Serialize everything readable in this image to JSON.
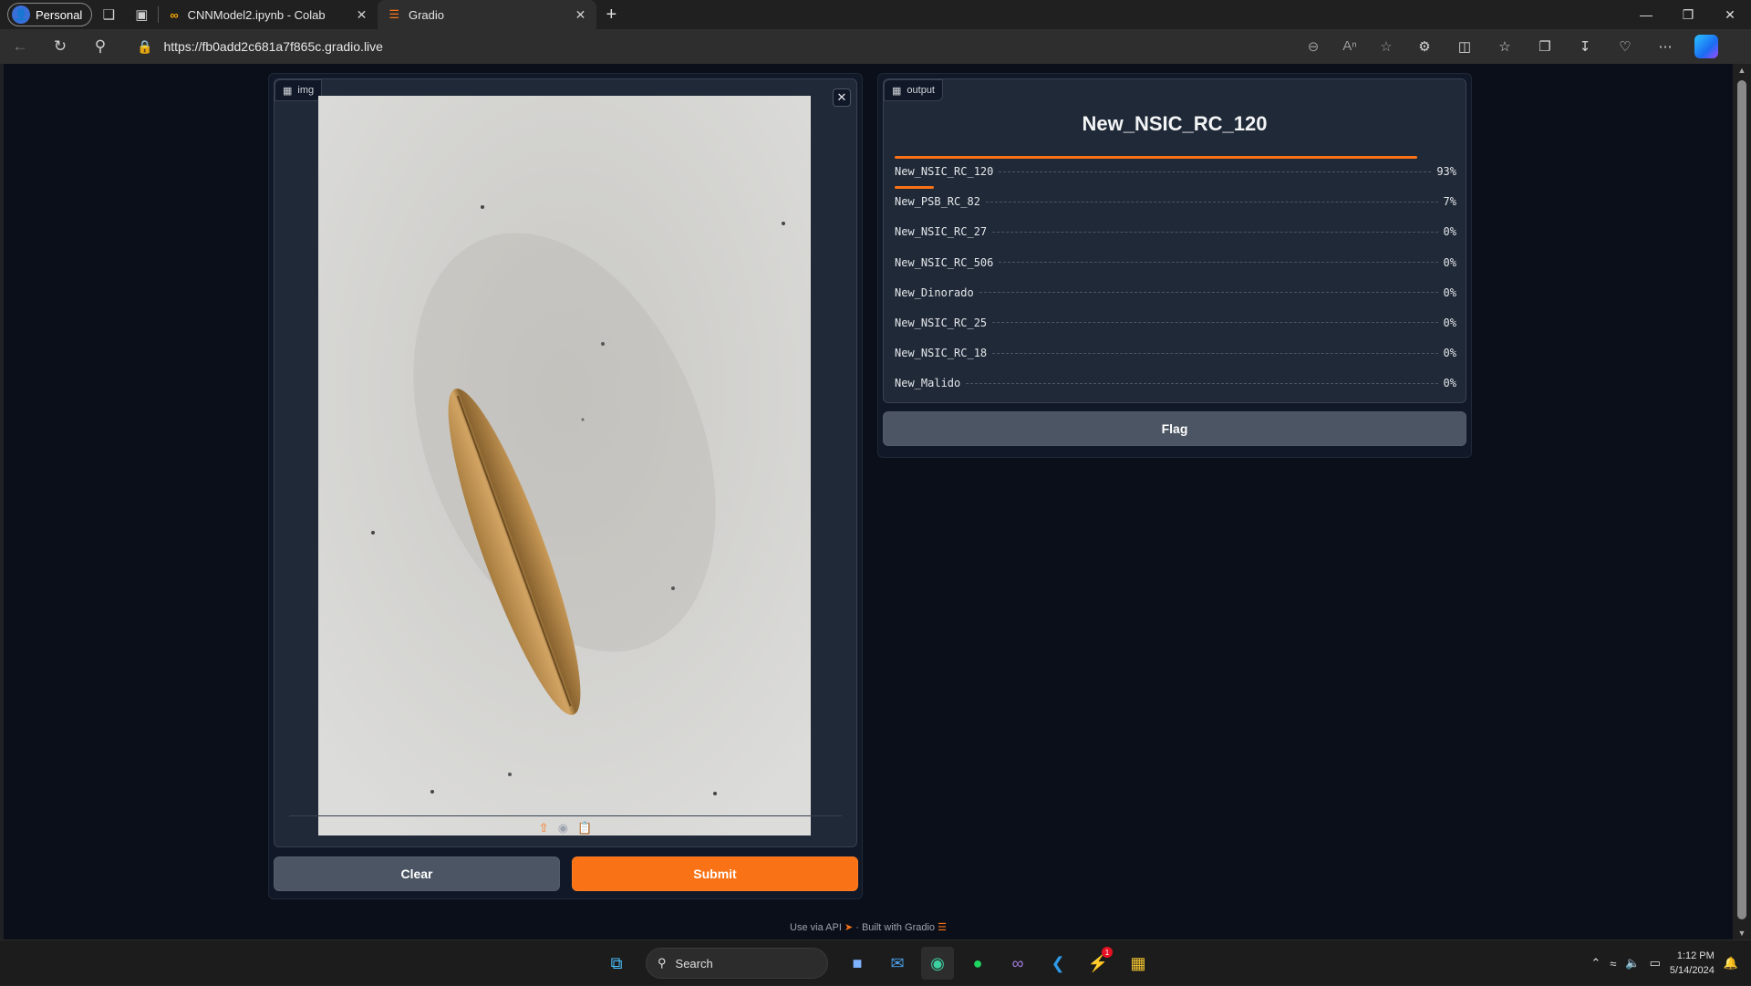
{
  "browser": {
    "profile_label": "Personal",
    "tabs": [
      {
        "label": "CNNModel2.ipynb - Colab",
        "icon": "colab-icon"
      },
      {
        "label": "Gradio",
        "icon": "gradio-icon"
      }
    ],
    "url": "https://fb0add2c681a7f865c.gradio.live"
  },
  "input_panel": {
    "block_label": "img",
    "clear_label": "Clear",
    "submit_label": "Submit"
  },
  "output_panel": {
    "block_label": "output",
    "top_label": "New_NSIC_RC_120",
    "confidences": [
      {
        "label": "New_NSIC_RC_120",
        "pct_text": "93%",
        "value": 0.93
      },
      {
        "label": "New_PSB_RC_82",
        "pct_text": "7%",
        "value": 0.07
      },
      {
        "label": "New_NSIC_RC_27",
        "pct_text": "0%",
        "value": 0
      },
      {
        "label": "New_NSIC_RC_506",
        "pct_text": "0%",
        "value": 0
      },
      {
        "label": "New_Dinorado",
        "pct_text": "0%",
        "value": 0
      },
      {
        "label": "New_NSIC_RC_25",
        "pct_text": "0%",
        "value": 0
      },
      {
        "label": "New_NSIC_RC_18",
        "pct_text": "0%",
        "value": 0
      },
      {
        "label": "New_Malido",
        "pct_text": "0%",
        "value": 0
      }
    ],
    "flag_label": "Flag"
  },
  "footer": {
    "api_label": "Use via API",
    "separator": "·",
    "built_label": "Built with Gradio"
  },
  "taskbar": {
    "search_label": "Search",
    "time": "1:12 PM",
    "date": "5/14/2024",
    "messenger_badge": "1"
  },
  "colors": {
    "accent": "#f97316",
    "page_bg": "#0b0f19",
    "panel_bg": "#1f2937"
  }
}
